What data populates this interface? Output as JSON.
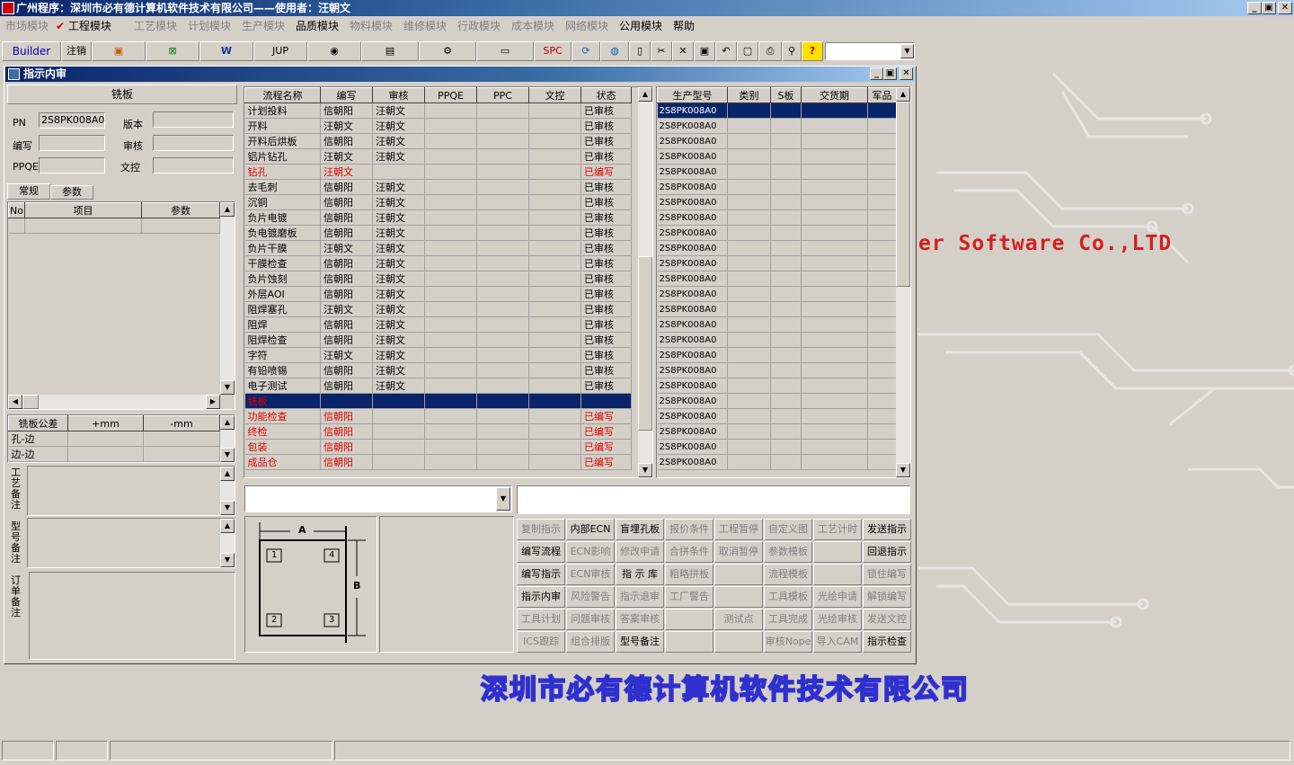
{
  "app_title": "广州程序：深圳市必有德计算机软件技术有限公司——使用者：汪朝文",
  "window_controls": [
    "_",
    "▣",
    "✕"
  ],
  "menu": [
    "市场模块",
    "工程模块",
    "工艺模块",
    "计划模块",
    "生产模块",
    "品质模块",
    "物料模块",
    "维修模块",
    "行政模块",
    "成本模块",
    "网络模块",
    "公用模块",
    "帮助"
  ],
  "menu_active": [
    1,
    5,
    11,
    12
  ],
  "toolbar": {
    "builder": "Builder",
    "logout": "注销",
    "jup": "JUP",
    "spc": "SPC"
  },
  "panel_title": "指示内审",
  "left": {
    "board_type": "铣板",
    "pn_label": "PN",
    "pn_value": "2S8PK008A0",
    "version_label": "版本",
    "version_value": "",
    "author_label": "编写",
    "author_value": "",
    "reviewer_label": "审核",
    "reviewer_value": "",
    "ppqe_label": "PPQE",
    "ppqe_value": "",
    "doc_control_label": "文控",
    "doc_control_value": "",
    "tabs": [
      "常规",
      "参数"
    ],
    "param_headers": [
      "No",
      "项目",
      "参数"
    ],
    "tolerance_headers": [
      "铣板公差",
      "+mm",
      "-mm"
    ],
    "tolerance_rows": [
      "孔-边",
      "边-边"
    ],
    "notes": [
      "工艺备注",
      "型号备注",
      "订单备注"
    ]
  },
  "process": {
    "headers": [
      "流程名称",
      "编写",
      "审核",
      "PPQE",
      "PPC",
      "文控",
      "状态"
    ],
    "rows": [
      {
        "name": "计划投料",
        "author": "信朝阳",
        "reviewer": "汪朝文",
        "status": "已审核",
        "type": "normal"
      },
      {
        "name": "开料",
        "author": "汪朝文",
        "reviewer": "汪朝文",
        "status": "已审核",
        "type": "normal"
      },
      {
        "name": "开料后烘板",
        "author": "信朝阳",
        "reviewer": "汪朝文",
        "status": "已审核",
        "type": "normal"
      },
      {
        "name": "铝片钻孔",
        "author": "汪朝文",
        "reviewer": "汪朝文",
        "status": "已审核",
        "type": "normal"
      },
      {
        "name": "钻孔",
        "author": "汪朝文",
        "reviewer": "",
        "status": "已编写",
        "type": "red"
      },
      {
        "name": "去毛刺",
        "author": "信朝阳",
        "reviewer": "汪朝文",
        "status": "已审核",
        "type": "normal"
      },
      {
        "name": "沉铜",
        "author": "信朝阳",
        "reviewer": "汪朝文",
        "status": "已审核",
        "type": "normal"
      },
      {
        "name": "负片电镀",
        "author": "信朝阳",
        "reviewer": "汪朝文",
        "status": "已审核",
        "type": "normal"
      },
      {
        "name": "负电镀磨板",
        "author": "信朝阳",
        "reviewer": "汪朝文",
        "status": "已审核",
        "type": "normal"
      },
      {
        "name": "负片干膜",
        "author": "汪朝文",
        "reviewer": "汪朝文",
        "status": "已审核",
        "type": "normal"
      },
      {
        "name": "干膜检查",
        "author": "信朝阳",
        "reviewer": "汪朝文",
        "status": "已审核",
        "type": "normal"
      },
      {
        "name": "负片蚀刻",
        "author": "信朝阳",
        "reviewer": "汪朝文",
        "status": "已审核",
        "type": "normal"
      },
      {
        "name": "外层AOI",
        "author": "信朝阳",
        "reviewer": "汪朝文",
        "status": "已审核",
        "type": "normal"
      },
      {
        "name": "阻焊塞孔",
        "author": "汪朝文",
        "reviewer": "汪朝文",
        "status": "已审核",
        "type": "normal"
      },
      {
        "name": "阻焊",
        "author": "信朝阳",
        "reviewer": "汪朝文",
        "status": "已审核",
        "type": "normal"
      },
      {
        "name": "阻焊检查",
        "author": "信朝阳",
        "reviewer": "汪朝文",
        "status": "已审核",
        "type": "normal"
      },
      {
        "name": "字符",
        "author": "汪朝文",
        "reviewer": "汪朝文",
        "status": "已审核",
        "type": "normal"
      },
      {
        "name": "有铅喷锡",
        "author": "信朝阳",
        "reviewer": "汪朝文",
        "status": "已审核",
        "type": "normal"
      },
      {
        "name": "电子测试",
        "author": "信朝阳",
        "reviewer": "汪朝文",
        "status": "已审核",
        "type": "normal"
      },
      {
        "name": "铣板",
        "author": "",
        "reviewer": "",
        "status": "",
        "type": "sel"
      },
      {
        "name": "功能检查",
        "author": "信朝阳",
        "reviewer": "",
        "status": "已编写",
        "type": "red"
      },
      {
        "name": "终检",
        "author": "信朝阳",
        "reviewer": "",
        "status": "已编写",
        "type": "red"
      },
      {
        "name": "包装",
        "author": "信朝阳",
        "reviewer": "",
        "status": "已编写",
        "type": "red"
      },
      {
        "name": "成品仓",
        "author": "信朝阳",
        "reviewer": "",
        "status": "已编写",
        "type": "red"
      }
    ]
  },
  "models": {
    "headers": [
      "生产型号",
      "类别",
      "S板",
      "交货期",
      "军品"
    ],
    "values": [
      "2S8PK008A0",
      "2S8PK008A0",
      "2S8PK008A0",
      "2S8PK008A0",
      "2S8PK008A0",
      "2S8PK008A0",
      "2S8PK008A0",
      "2S8PK008A0",
      "2S8PK008A0",
      "2S8PK008A0",
      "2S8PK008A0",
      "2S8PK008A0",
      "2S8PK008A0",
      "2S8PK008A0",
      "2S8PK008A0",
      "2S8PK008A0",
      "2S8PK008A0",
      "2S8PK008A0",
      "2S8PK008A0",
      "2S8PK008A0",
      "2S8PK008A0",
      "2S8PK008A0",
      "2S8PK008A0",
      "2S8PK008A0"
    ]
  },
  "diagram": {
    "a": "A",
    "b": "B",
    "n1": "1",
    "n2": "2",
    "n3": "3",
    "n4": "4"
  },
  "actions": [
    [
      "复制指示",
      "内部ECN",
      "盲埋孔板",
      "报价条件",
      "工程暂停",
      "自定义图",
      "工艺计时",
      "发送指示"
    ],
    [
      "编写流程",
      "ECN影响",
      "修改申请",
      "合拼条件",
      "取消暂停",
      "参数模板",
      "",
      "回退指示"
    ],
    [
      "编写指示",
      "ECN审核",
      "指 示 库",
      "粗略拼板",
      "",
      "流程模板",
      "",
      "锁住编写"
    ],
    [
      "指示内审",
      "风险警告",
      "指示退审",
      "工厂警告",
      "",
      "工具模板",
      "光绘申请",
      "解锁编写"
    ],
    [
      "工具计划",
      "问题审核",
      "答案审核",
      "",
      "测试点",
      "工具完成",
      "光绘审核",
      "发送文控"
    ],
    [
      "ICS跟踪",
      "组合排版",
      "型号备注",
      "",
      "",
      "审核Nope",
      "导入CAM",
      "指示检查"
    ]
  ],
  "actions_enabled": [
    [
      0,
      1,
      1,
      0,
      0,
      0,
      0,
      1
    ],
    [
      1,
      0,
      0,
      0,
      0,
      0,
      0,
      1
    ],
    [
      1,
      0,
      1,
      0,
      0,
      0,
      0,
      0
    ],
    [
      1,
      0,
      0,
      0,
      0,
      0,
      0,
      0
    ],
    [
      0,
      0,
      0,
      0,
      0,
      0,
      0,
      0
    ],
    [
      0,
      0,
      1,
      0,
      0,
      0,
      0,
      1
    ]
  ],
  "watermark_en": "er Software Co.,LTD",
  "watermark_cn": "深圳市必有德计算机软件技术有限公司"
}
